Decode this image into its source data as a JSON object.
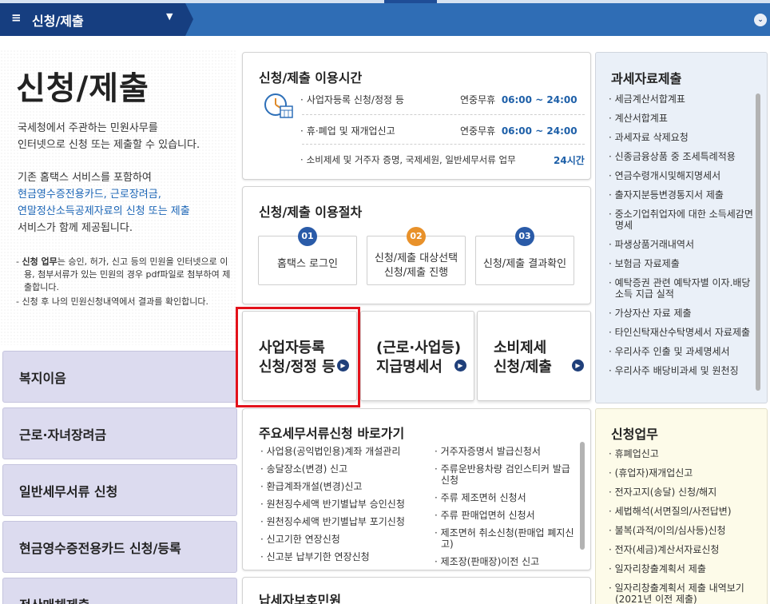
{
  "topbar": {
    "menu_icon": "≡",
    "title": "신청/제출",
    "caret": "▼",
    "expand_icon": "⌄"
  },
  "intro": {
    "title": "신청/제출",
    "line1": "국세청에서 주관하는 민원사무를",
    "line2": "인터넷으로 신청 또는 제출할 수 있습니다.",
    "line3": "기존 홈택스 서비스를 포함하여",
    "line4": "현금영수증전용카드, 근로장려금,",
    "line5": "연말정산소득공제자료의 신청 또는 제출",
    "line6": "서비스가 함께 제공됩니다.",
    "note1_bold": "신청 업무",
    "note1_rest": "는 승인, 허가, 신고 등의 민원을 인터넷으로 이용, 첨부서류가 있는 민원의 경우 pdf파일로 첨부하여 제출합니다.",
    "note2": "신청 후 나의 민원신청내역에서 결과를 확인합니다."
  },
  "side_buttons": [
    "복지이음",
    "근로·자녀장려금",
    "일반세무서류 신청",
    "현금영수증전용카드 신청/등록",
    "전산매체제출"
  ],
  "hours": {
    "title": "신청/제출 이용시간",
    "rows": [
      {
        "label": "사업자등록 신청/정정 등",
        "days": "연중무휴",
        "time": "06:00 ~ 24:00"
      },
      {
        "label": "휴·폐업 및 재개업신고",
        "days": "연중무휴",
        "time": "06:00 ~ 24:00"
      },
      {
        "label": "소비제세 및 거주자 증명, 국제세원, 일반세무서류 업무",
        "days": "",
        "time": "24시간"
      }
    ]
  },
  "procedure": {
    "title": "신청/제출 이용절차",
    "steps": [
      {
        "num": "01",
        "label": "홈택스 로그인",
        "color": "#2a5ba8"
      },
      {
        "num": "02",
        "label1": "신청/제출 대상선택",
        "label2": "신청/제출 진행",
        "color": "#e8912a"
      },
      {
        "num": "03",
        "label": "신청/제출 결과확인",
        "color": "#2a5ba8"
      }
    ]
  },
  "quick": [
    {
      "line1": "사업자등록",
      "line2": "신청/정정 등"
    },
    {
      "line1": "(근로·사업등)",
      "line2": "지급명세서"
    },
    {
      "line1": "소비제세",
      "line2": "신청/제출"
    }
  ],
  "forms": {
    "title": "주요세무서류신청 바로가기",
    "col1": [
      "사업용(공익법인용)계좌 개설관리",
      "송달장소(변경) 신고",
      "환급계좌개설(변경)신고",
      "원천징수세액 반기별납부 승인신청",
      "원천징수세액 반기별납부 포기신청",
      "신고기한 연장신청",
      "신고분 납부기한 연장신청"
    ],
    "col2": [
      "거주자증명서 발급신청서",
      "주류운반용차량 검인스티커 발급신청",
      "주류 제조면허 신청서",
      "주류 판매업면허 신청서",
      "제조면허 취소신청(판매업 폐지신고)",
      "제조장(판매장)이전 신고"
    ]
  },
  "taxpayer": {
    "title": "납세자보호민원"
  },
  "tax_data": {
    "title": "과세자료제출",
    "items": [
      "세금계산서합계표",
      "계산서합계표",
      "과세자료 삭제요청",
      "신종금융상품 중 조세특례적용",
      "연금수령개시및해지명세서",
      "출자지분등변경통지서 제출",
      "중소기업취업자에 대한 소득세감면명세",
      "파생상품거래내역서",
      "보험금 자료제출",
      "예탁증권 관련 예탁자별 이자.배당소득 지급 실적",
      "가상자산 자료 제출",
      "타인신탁재산수탁명세서 자료제출",
      "우리사주 인출 및 과세명세서",
      "우리사주 배당비과세 및 원천징"
    ]
  },
  "apply": {
    "title": "신청업무",
    "items": [
      "휴폐업신고",
      "(휴업자)재개업신고",
      "전자고지(송달) 신청/해지",
      "세법해석(서면질의/사전답변)",
      "불복(과적/이의/심사등)신청",
      "전자(세금)계산서자료신청",
      "일자리창출계획서 제출",
      "일자리창출계획서 제출 내역보기(2021년 이전 제출)"
    ]
  },
  "icons": {
    "clock": "clock-calendar-icon",
    "arrow": "▶"
  }
}
